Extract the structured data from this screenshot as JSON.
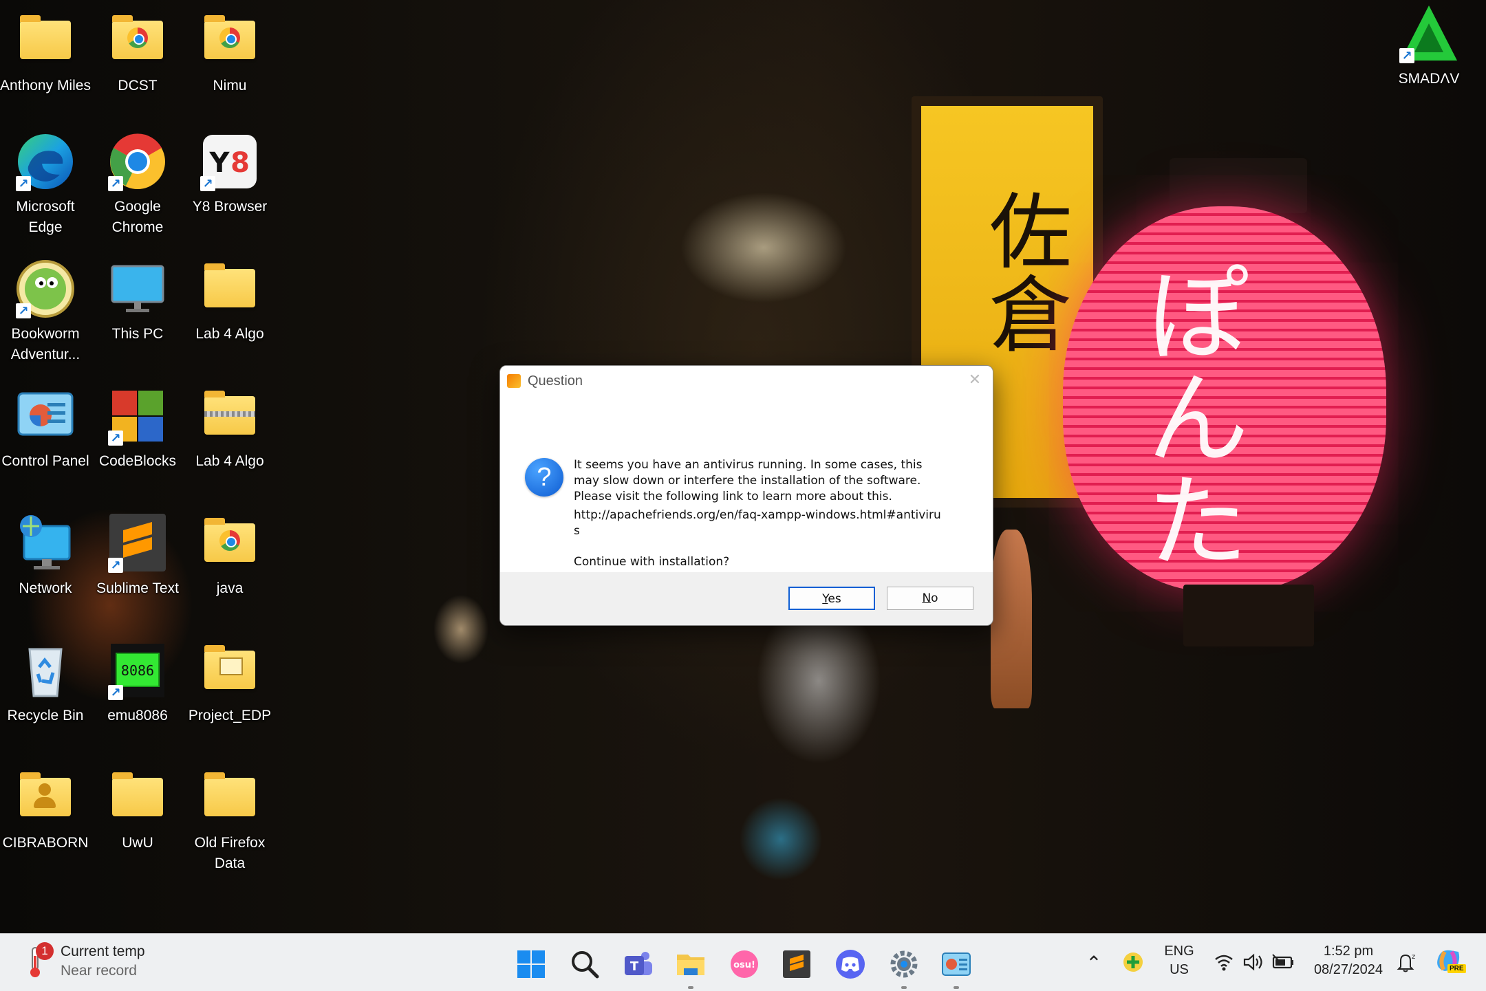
{
  "desktop": {
    "icons": [
      {
        "label": "Anthony Miles",
        "icon": "folder-icon"
      },
      {
        "label": "DCST",
        "icon": "chrome-folder-icon"
      },
      {
        "label": "Nimu",
        "icon": "chrome-folder-icon"
      },
      {
        "label": "Microsoft Edge",
        "icon": "edge-icon"
      },
      {
        "label": "Google Chrome",
        "icon": "chrome-icon"
      },
      {
        "label": "Y8 Browser",
        "icon": "y8-icon"
      },
      {
        "label": "Bookworm Adventur...",
        "icon": "bookworm-icon"
      },
      {
        "label": "This PC",
        "icon": "monitor-icon"
      },
      {
        "label": "Lab 4 Algo",
        "icon": "folder-icon"
      },
      {
        "label": "Control Panel",
        "icon": "control-panel-icon"
      },
      {
        "label": "CodeBlocks",
        "icon": "codeblocks-icon"
      },
      {
        "label": "Lab 4 Algo",
        "icon": "zip-folder-icon"
      },
      {
        "label": "Network",
        "icon": "network-icon"
      },
      {
        "label": "Sublime Text",
        "icon": "sublime-icon"
      },
      {
        "label": "java",
        "icon": "chrome-folder-icon"
      },
      {
        "label": "Recycle Bin",
        "icon": "recycle-bin-icon"
      },
      {
        "label": "emu8086",
        "icon": "chip-icon"
      },
      {
        "label": "Project_EDP",
        "icon": "folder-icon"
      },
      {
        "label": "CIBRABORN",
        "icon": "user-folder-icon"
      },
      {
        "label": "UwU",
        "icon": "folder-icon"
      },
      {
        "label": "Old Firefox Data",
        "icon": "folder-icon"
      },
      {
        "label": "SMADΛV",
        "icon": "smadav-icon"
      }
    ]
  },
  "dialog": {
    "title": "Question",
    "message": "It seems you have an antivirus running. In some cases, this may slow down or interfere the installation of the software. Please visit the following link to learn more about this.",
    "link": "http://apachefriends.org/en/faq-xampp-windows.html#antivirus",
    "prompt": "Continue with installation?",
    "yes_rest": "es",
    "yes_key": "Y",
    "no_key": "N",
    "no_rest": "o"
  },
  "taskbar": {
    "weather": {
      "badge": "1",
      "title": "Current temp",
      "subtitle": "Near record"
    },
    "apps": [
      "windows-start-icon",
      "search-icon",
      "teams-icon",
      "file-explorer-icon",
      "osu-icon",
      "sublime-icon",
      "discord-icon",
      "settings-icon",
      "control-panel-icon"
    ],
    "osu_label": "osu!",
    "tray": {
      "lang_top": "ENG",
      "lang_bottom": "US",
      "time": "1:52 pm",
      "date": "08/27/2024",
      "copilot_badge": "PRE"
    }
  }
}
